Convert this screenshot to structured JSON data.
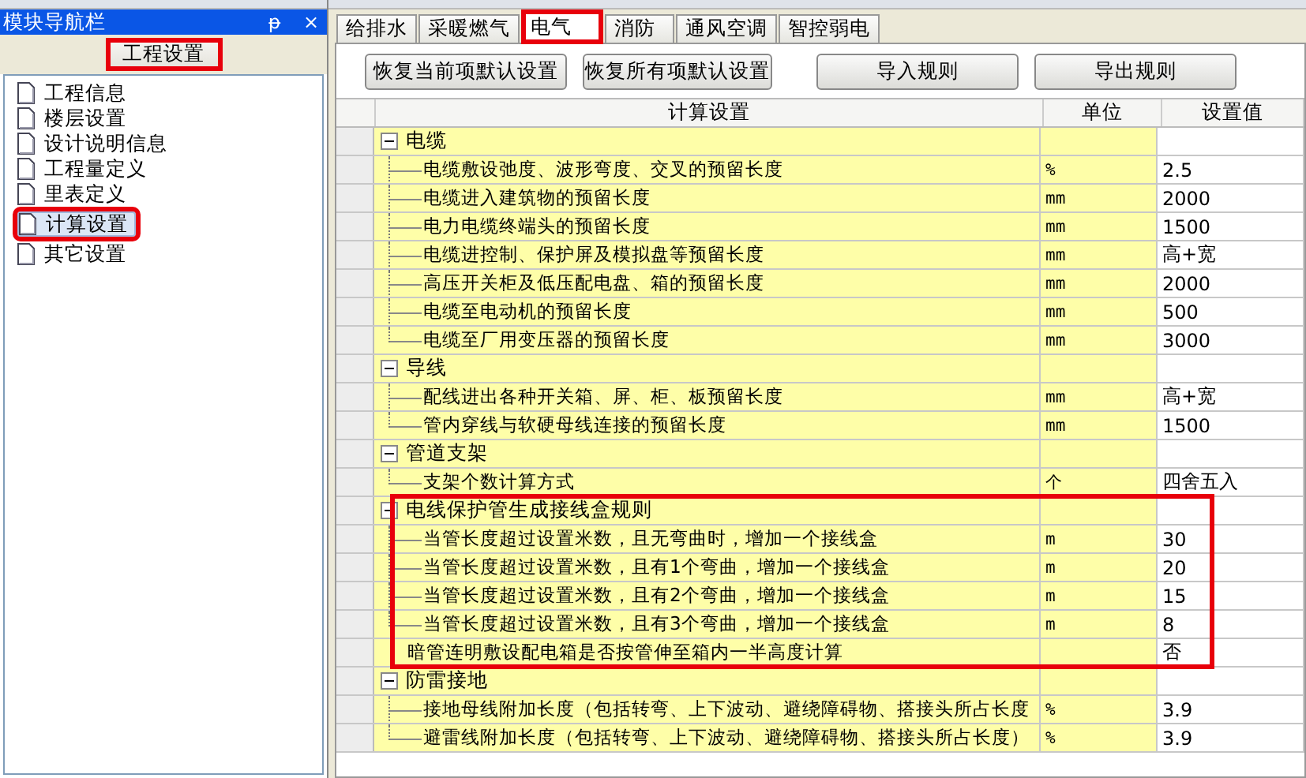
{
  "nav_panel": {
    "title": "模块导航栏",
    "pin": "ᵽ",
    "close": "×",
    "section_button": {
      "label": "工程设置",
      "highlighted": true
    },
    "items": [
      {
        "label": "工程信息",
        "selected": false,
        "highlighted": false
      },
      {
        "label": "楼层设置",
        "selected": false,
        "highlighted": false
      },
      {
        "label": "设计说明信息",
        "selected": false,
        "highlighted": false
      },
      {
        "label": "工程量定义",
        "selected": false,
        "highlighted": false
      },
      {
        "label": "里表定义",
        "selected": false,
        "highlighted": false
      },
      {
        "label": "计算设置",
        "selected": true,
        "highlighted": true
      },
      {
        "label": "其它设置",
        "selected": false,
        "highlighted": false
      }
    ]
  },
  "tabs": [
    {
      "label": "给排水",
      "selected": false,
      "highlighted": false
    },
    {
      "label": "采暖燃气",
      "selected": false,
      "highlighted": false
    },
    {
      "label": "电气",
      "selected": true,
      "highlighted": true
    },
    {
      "label": "消防",
      "selected": false,
      "highlighted": false
    },
    {
      "label": "通风空调",
      "selected": false,
      "highlighted": false
    },
    {
      "label": "智控弱电",
      "selected": false,
      "highlighted": false
    }
  ],
  "buttons": [
    "恢复当前项默认设置",
    "恢复所有项默认设置",
    "导入规则",
    "导出规则"
  ],
  "table": {
    "columns": [
      "计算设置",
      "单位",
      "设置值"
    ],
    "rows": [
      {
        "kind": "group",
        "label": "电缆",
        "expanded": true,
        "highlighted": false,
        "children": [
          {
            "label": "电缆敷设弛度、波形弯度、交叉的预留长度",
            "unit": "%",
            "value": "2.5"
          },
          {
            "label": "电缆进入建筑物的预留长度",
            "unit": "mm",
            "value": "2000"
          },
          {
            "label": "电力电缆终端头的预留长度",
            "unit": "mm",
            "value": "1500"
          },
          {
            "label": "电缆进控制、保护屏及模拟盘等预留长度",
            "unit": "mm",
            "value": "高+宽"
          },
          {
            "label": "高压开关柜及低压配电盘、箱的预留长度",
            "unit": "mm",
            "value": "2000"
          },
          {
            "label": "电缆至电动机的预留长度",
            "unit": "mm",
            "value": "500"
          },
          {
            "label": "电缆至厂用变压器的预留长度",
            "unit": "mm",
            "value": "3000"
          }
        ]
      },
      {
        "kind": "group",
        "label": "导线",
        "expanded": true,
        "highlighted": false,
        "children": [
          {
            "label": "配线进出各种开关箱、屏、柜、板预留长度",
            "unit": "mm",
            "value": "高+宽"
          },
          {
            "label": "管内穿线与软硬母线连接的预留长度",
            "unit": "mm",
            "value": "1500"
          }
        ]
      },
      {
        "kind": "group",
        "label": "管道支架",
        "expanded": true,
        "highlighted": false,
        "children": [
          {
            "label": "支架个数计算方式",
            "unit": "个",
            "value": "四舍五入"
          }
        ]
      },
      {
        "kind": "group",
        "label": "电线保护管生成接线盒规则",
        "expanded": true,
        "highlighted": true,
        "children": [
          {
            "label": "当管长度超过设置米数，且无弯曲时，增加一个接线盒",
            "unit": "m",
            "value": "30"
          },
          {
            "label": "当管长度超过设置米数，且有1个弯曲，增加一个接线盒",
            "unit": "m",
            "value": "20"
          },
          {
            "label": "当管长度超过设置米数，且有2个弯曲，增加一个接线盒",
            "unit": "m",
            "value": "15"
          },
          {
            "label": "当管长度超过设置米数，且有3个弯曲，增加一个接线盒",
            "unit": "m",
            "value": "8"
          }
        ]
      },
      {
        "kind": "setting",
        "label": "暗管连明敷设配电箱是否按管伸至箱内一半高度计算",
        "unit": "",
        "value": "否",
        "highlighted": true
      },
      {
        "kind": "group",
        "label": "防雷接地",
        "expanded": true,
        "highlighted": false,
        "children": [
          {
            "label": "接地母线附加长度（包括转弯、上下波动、避绕障碍物、搭接头所占长度",
            "unit": "%",
            "value": "3.9"
          },
          {
            "label": "避雷线附加长度（包括转弯、上下波动、避绕障碍物、搭接头所占长度）",
            "unit": "%",
            "value": "3.9"
          }
        ]
      }
    ]
  }
}
